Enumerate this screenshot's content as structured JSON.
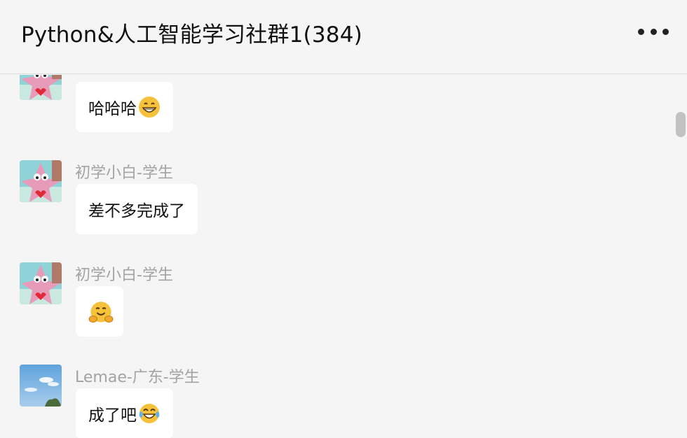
{
  "header": {
    "title": "Python&人工智能学习社群1(384)",
    "more_icon": "more-dots-icon"
  },
  "messages": [
    {
      "sender": "",
      "avatar": "patrick-star-avatar",
      "text": "哈哈哈",
      "emoji": "grinning-face-emoji"
    },
    {
      "sender": "初学小白-学生",
      "avatar": "patrick-star-avatar",
      "text": "差不多完成了",
      "emoji": ""
    },
    {
      "sender": "初学小白-学生",
      "avatar": "patrick-star-avatar",
      "text": "",
      "emoji": "hugging-face-emoji"
    },
    {
      "sender": "Lemae-广东-学生",
      "avatar": "sky-photo-avatar",
      "text": "成了吧",
      "emoji": "tears-of-joy-emoji"
    }
  ],
  "colors": {
    "background": "#f5f5f5",
    "bubble": "#ffffff",
    "sender_name": "#a3a3a3",
    "emoji_yellow": "#f7c23b"
  }
}
